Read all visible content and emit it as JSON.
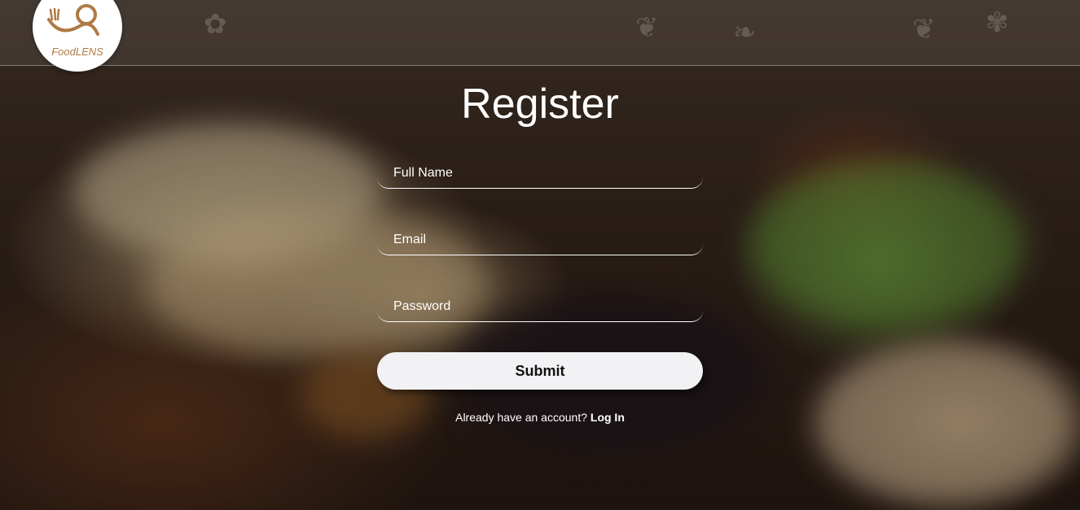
{
  "brand": {
    "logo_text": "FoodLENS",
    "accent_color": "#b07a45"
  },
  "form": {
    "title": "Register",
    "fields": [
      {
        "placeholder": "Full Name",
        "value": ""
      },
      {
        "placeholder": "Email",
        "value": ""
      },
      {
        "placeholder": "Password",
        "value": ""
      }
    ],
    "submit_label": "Submit",
    "account_prompt": "Already have an account?",
    "login_link": "Log In"
  }
}
